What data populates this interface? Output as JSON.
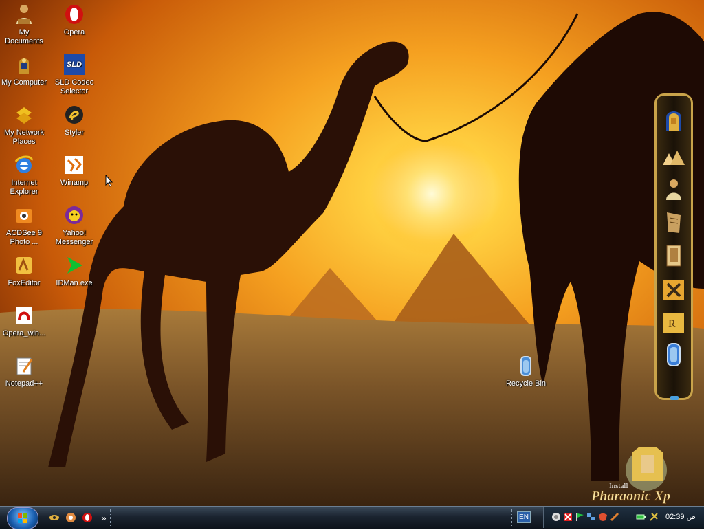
{
  "desktop": {
    "icons": [
      {
        "id": "my-documents",
        "label": "My Documents"
      },
      {
        "id": "opera",
        "label": "Opera"
      },
      {
        "id": "my-computer",
        "label": "My Computer"
      },
      {
        "id": "sld-codec",
        "label": "SLD Codec Selector"
      },
      {
        "id": "my-network",
        "label": "My Network Places"
      },
      {
        "id": "styler",
        "label": "Styler"
      },
      {
        "id": "ie",
        "label": "Internet Explorer"
      },
      {
        "id": "winamp",
        "label": "Winamp"
      },
      {
        "id": "acdsee",
        "label": "ACDSee 9 Photo ..."
      },
      {
        "id": "yahoo",
        "label": "Yahoo! Messenger"
      },
      {
        "id": "foxeditor",
        "label": "FoxEditor"
      },
      {
        "id": "idman",
        "label": "IDMan.exe"
      },
      {
        "id": "opera-win",
        "label": "Opera_win..."
      },
      {
        "id": "notepadpp",
        "label": "Notepad++"
      },
      {
        "id": "recycle",
        "label": "Recycle Bin"
      }
    ],
    "sld_icon_text": "SLD",
    "brand_text": "Install Pharaonic Xp",
    "brand_small": "Install",
    "brand_large": "Pharaonic Xp"
  },
  "taskbar": {
    "language": "EN",
    "clock": "02:39 ص",
    "quicklaunch_more": "»"
  },
  "colors": {
    "sky": "#f5a623",
    "sun": "#fff3a0",
    "sand": "#7a5a2c",
    "taskbar": "#1b2430"
  }
}
